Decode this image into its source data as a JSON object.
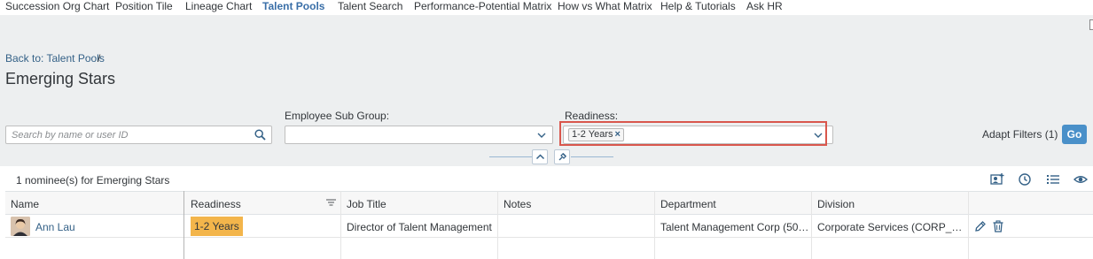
{
  "nav": {
    "tabs": [
      {
        "label": "Succession Org Chart",
        "active": false
      },
      {
        "label": "Position Tile",
        "active": false
      },
      {
        "label": "Lineage Chart",
        "active": false
      },
      {
        "label": "Talent Pools",
        "active": true
      },
      {
        "label": "Talent Search",
        "active": false
      },
      {
        "label": "Performance-Potential Matrix",
        "active": false
      },
      {
        "label": "How vs What Matrix",
        "active": false
      },
      {
        "label": "Help & Tutorials",
        "active": false
      },
      {
        "label": "Ask HR",
        "active": false
      }
    ]
  },
  "breadcrumb": {
    "back_label": "Back to: Talent Pools",
    "separator": "/"
  },
  "page": {
    "title": "Emerging Stars"
  },
  "filters": {
    "search": {
      "placeholder": "Search by name or user ID",
      "value": ""
    },
    "employee_sub_group": {
      "label": "Employee Sub Group:",
      "value": ""
    },
    "readiness": {
      "label": "Readiness:",
      "tokens": [
        "1-2 Years"
      ],
      "token_remove": "×"
    },
    "adapt_filters_label": "Adapt Filters (1)",
    "go_label": "Go"
  },
  "table": {
    "count_text": "1 nominee(s) for Emerging Stars",
    "columns": [
      "Name",
      "Readiness",
      "Job Title",
      "Notes",
      "Department",
      "Division"
    ],
    "rows": [
      {
        "name": "Ann Lau",
        "readiness": "1-2 Years",
        "job_title": "Director of Talent Management",
        "notes": "",
        "department": "Talent Management Corp (500...",
        "division": "Corporate Services (CORP_SV..."
      }
    ],
    "toolbar_icons": [
      "add-nominee-icon",
      "history-icon",
      "list-view-icon",
      "visibility-icon"
    ]
  },
  "colors": {
    "accent": "#4a90c9",
    "active_tab": "#3a6fa8",
    "link": "#346187",
    "readiness_badge": "#f3b54b",
    "highlight": "#d9574d"
  }
}
